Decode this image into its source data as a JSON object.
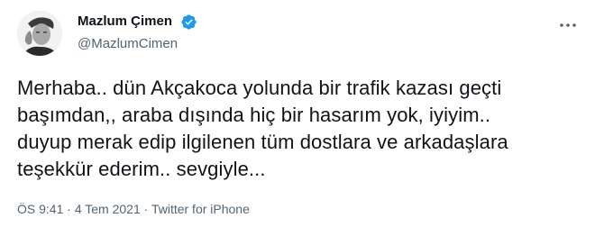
{
  "author": {
    "name": "Mazlum Çimen",
    "handle": "@MazlumCimen",
    "verified": true,
    "verified_color": "#1d9bf0"
  },
  "tweet": {
    "lines": [
      "Merhaba.. dün Akçakoca yolunda bir trafik kazası geçti",
      "başımdan,, araba dışında hiç bir hasarım yok, iyiyim..",
      "duyup merak edip ilgilenen tüm dostlara ve arkadaşlara",
      "teşekkür ederim.. sevgiyle..."
    ]
  },
  "meta": {
    "time": "ÖS 9:41",
    "separator": "·",
    "date": "4 Tem 2021",
    "source": "Twitter for iPhone"
  },
  "icons": {
    "verified": "verified-badge-icon",
    "more": "more-options-icon"
  },
  "colors": {
    "text": "#0f1419",
    "secondary": "#536471",
    "accent": "#1d9bf0"
  }
}
